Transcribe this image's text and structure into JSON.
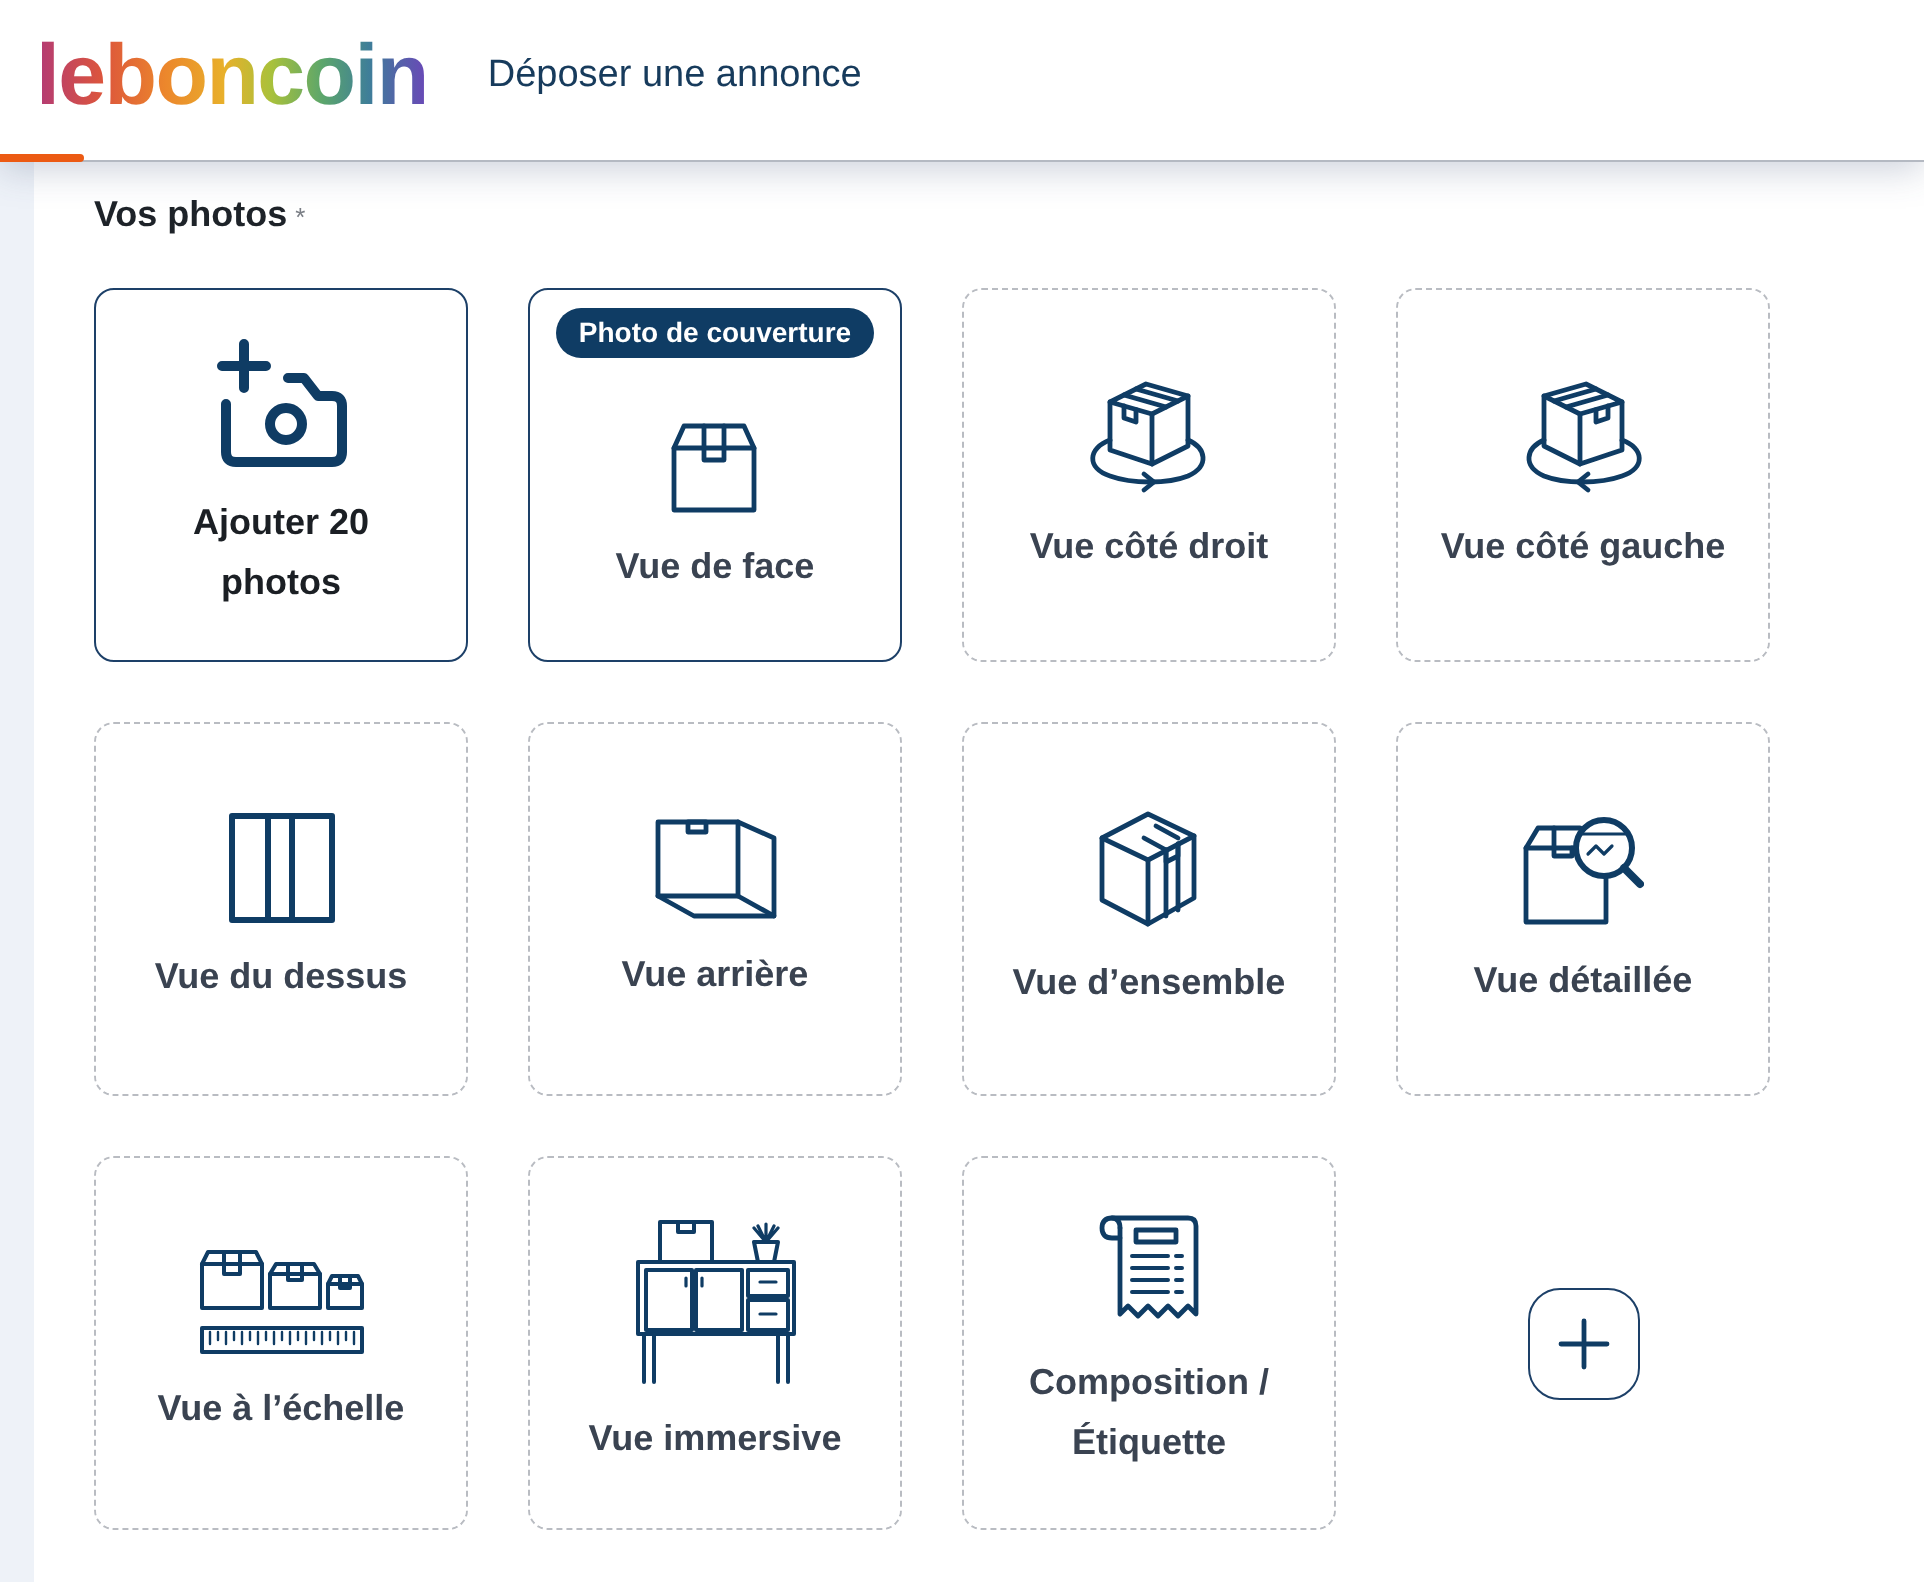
{
  "header": {
    "logo": "leboncoin",
    "link": "Déposer une annonce"
  },
  "photos": {
    "title": "Vos photos",
    "required_mark": "*",
    "slots": [
      {
        "kind": "add",
        "label": "Ajouter 20 photos"
      },
      {
        "kind": "view",
        "label": "Vue de face",
        "badge": "Photo de couverture",
        "highlighted": true
      },
      {
        "kind": "view",
        "label": "Vue côté droit",
        "highlighted": false
      },
      {
        "kind": "view",
        "label": "Vue côté gauche",
        "highlighted": false
      },
      {
        "kind": "view",
        "label": "Vue du dessus",
        "highlighted": false
      },
      {
        "kind": "view",
        "label": "Vue arrière",
        "highlighted": false
      },
      {
        "kind": "view",
        "label": "Vue d’ensemble",
        "highlighted": false
      },
      {
        "kind": "view",
        "label": "Vue détaillée",
        "highlighted": false
      },
      {
        "kind": "view",
        "label": "Vue à l’échelle",
        "highlighted": false
      },
      {
        "kind": "view",
        "label": "Vue immersive",
        "highlighted": false
      },
      {
        "kind": "view",
        "label": "Composition / Étiquette",
        "highlighted": false
      },
      {
        "kind": "more"
      }
    ]
  }
}
